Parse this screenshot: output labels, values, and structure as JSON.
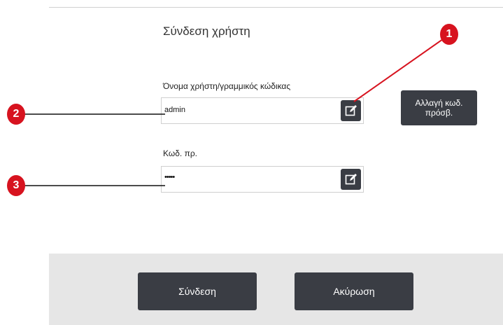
{
  "login": {
    "title": "Σύνδεση χρήστη",
    "username_label": "Όνομα χρήστη/γραμμικός κώδικας",
    "username_value": "admin",
    "password_label": "Κωδ. πρ.",
    "password_value": "•••••",
    "change_password_label": "Αλλαγή κωδ. πρόσβ.",
    "login_button": "Σύνδεση",
    "cancel_button": "Ακύρωση"
  },
  "callouts": [
    "1",
    "2",
    "3"
  ],
  "colors": {
    "callout": "#d7131f",
    "button": "#3a3d44",
    "footer": "#e6e6e6"
  },
  "icons": {
    "edit": "edit-icon"
  }
}
